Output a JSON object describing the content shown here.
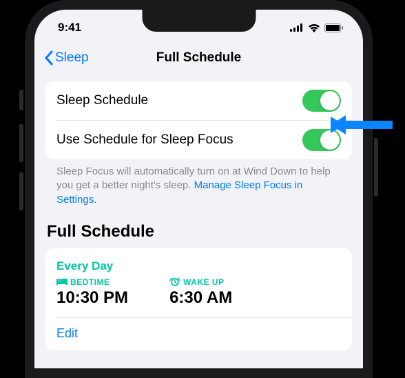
{
  "status": {
    "time": "9:41"
  },
  "nav": {
    "back_label": "Sleep",
    "title": "Full Schedule"
  },
  "toggles": {
    "sleep_schedule_label": "Sleep Schedule",
    "sleep_focus_label": "Use Schedule for Sleep Focus",
    "sleep_schedule_on": true,
    "sleep_focus_on": true
  },
  "footer": {
    "text": "Sleep Focus will automatically turn on at Wind Down to help you get a better night's sleep. ",
    "link": "Manage Sleep Focus in Settings."
  },
  "section": {
    "header": "Full Schedule"
  },
  "schedule": {
    "frequency": "Every Day",
    "bedtime_label": "BEDTIME",
    "bedtime_value": "10:30 PM",
    "wakeup_label": "WAKE UP",
    "wakeup_value": "6:30 AM",
    "edit_label": "Edit"
  },
  "colors": {
    "accent_blue": "#007aff",
    "toggle_green": "#34c759",
    "teal": "#00c7a5",
    "callout_arrow": "#0a84ff"
  }
}
